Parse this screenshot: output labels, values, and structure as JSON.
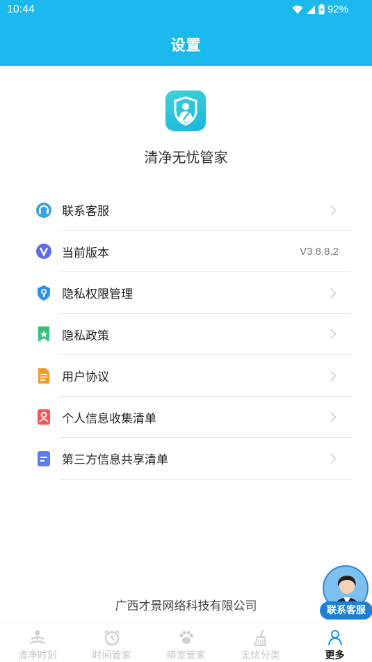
{
  "status_bar": {
    "time": "10:44",
    "battery": "92%"
  },
  "app_bar": {
    "title": "设置"
  },
  "app": {
    "name": "清净无忧管家"
  },
  "menu": [
    {
      "label": "联系客服",
      "value": "",
      "icon": "headset-icon",
      "color": "#3aa0e8"
    },
    {
      "label": "当前版本",
      "value": "V3.8.8.2",
      "icon": "version-v-icon",
      "color": "#5b6ee8"
    },
    {
      "label": "隐私权限管理",
      "value": "",
      "icon": "shield-key-icon",
      "color": "#2f8fe8"
    },
    {
      "label": "隐私政策",
      "value": "",
      "icon": "bookmark-star-icon",
      "color": "#34c27a"
    },
    {
      "label": "用户协议",
      "value": "",
      "icon": "document-icon",
      "color": "#f59a2a"
    },
    {
      "label": "个人信息收集清单",
      "value": "",
      "icon": "person-card-icon",
      "color": "#f0575a"
    },
    {
      "label": "第三方信息共享清单",
      "value": "",
      "icon": "list-doc-icon",
      "color": "#5a7ef0"
    }
  ],
  "footer": {
    "company": "广西才景网络科技有限公司"
  },
  "floating": {
    "label": "联系客服"
  },
  "tabs": [
    {
      "label": "清净时刻",
      "icon": "meditation-icon",
      "active": false
    },
    {
      "label": "时间管家",
      "icon": "alarm-clock-icon",
      "active": false
    },
    {
      "label": "萌宠管家",
      "icon": "paw-icon",
      "active": false
    },
    {
      "label": "无忧分类",
      "icon": "broom-icon",
      "active": false
    },
    {
      "label": "更多",
      "icon": "person-icon",
      "active": true
    }
  ]
}
